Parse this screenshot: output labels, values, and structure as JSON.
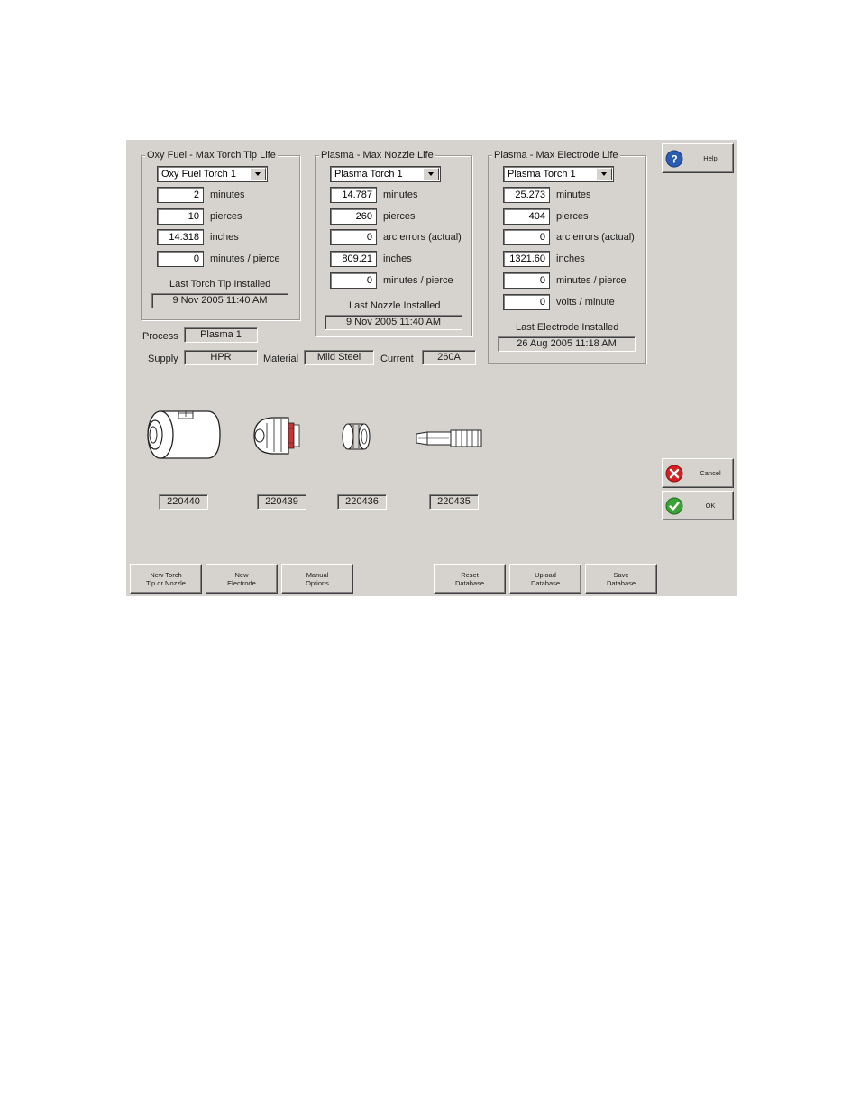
{
  "oxy_group": {
    "title": "Oxy Fuel - Max Torch Tip Life",
    "torch_select": "Oxy Fuel Torch 1",
    "rows": [
      {
        "value": "2",
        "unit": "minutes"
      },
      {
        "value": "10",
        "unit": "pierces"
      },
      {
        "value": "14.318",
        "unit": "inches"
      },
      {
        "value": "0",
        "unit": "minutes / pierce"
      }
    ],
    "last_label": "Last Torch Tip Installed",
    "last_date": "9 Nov 2005  11:40 AM"
  },
  "nozzle_group": {
    "title": "Plasma - Max Nozzle Life",
    "torch_select": "Plasma Torch 1",
    "rows": [
      {
        "value": "14.787",
        "unit": "minutes"
      },
      {
        "value": "260",
        "unit": "pierces"
      },
      {
        "value": "0",
        "unit": "arc errors (actual)"
      },
      {
        "value": "809.21",
        "unit": "inches"
      },
      {
        "value": "0",
        "unit": "minutes / pierce"
      }
    ],
    "last_label": "Last Nozzle Installed",
    "last_date": "9 Nov 2005  11:40 AM"
  },
  "electrode_group": {
    "title": "Plasma - Max Electrode Life",
    "torch_select": "Plasma Torch 1",
    "rows": [
      {
        "value": "25.273",
        "unit": "minutes"
      },
      {
        "value": "404",
        "unit": "pierces"
      },
      {
        "value": "0",
        "unit": "arc errors (actual)"
      },
      {
        "value": "1321.60",
        "unit": "inches"
      },
      {
        "value": "0",
        "unit": "minutes / pierce"
      },
      {
        "value": "0",
        "unit": "volts / minute"
      }
    ],
    "last_label": "Last Electrode Installed",
    "last_date": "26 Aug 2005  11:18 AM"
  },
  "process": {
    "process_label": "Process",
    "process_value": "Plasma 1",
    "supply_label": "Supply",
    "supply_value": "HPR",
    "material_label": "Material",
    "material_value": "Mild Steel",
    "current_label": "Current",
    "current_value": "260A"
  },
  "parts": [
    {
      "number": "220440",
      "icon": "shield-cap-icon"
    },
    {
      "number": "220439",
      "icon": "nozzle-retaining-cap-icon"
    },
    {
      "number": "220436",
      "icon": "swirl-ring-icon"
    },
    {
      "number": "220435",
      "icon": "electrode-icon"
    }
  ],
  "side_buttons": {
    "help": "Help",
    "cancel": "Cancel",
    "ok": "OK"
  },
  "bottom_buttons": {
    "new_torch_tip": "New Torch\nTip or Nozzle",
    "new_electrode": "New\nElectrode",
    "manual_options": "Manual\nOptions",
    "reset_database": "Reset\nDatabase",
    "upload_database": "Upload\nDatabase",
    "save_database": "Save\nDatabase"
  },
  "colors": {
    "panel": "#d6d3ce",
    "help_icon": "#2a5db0",
    "cancel_icon": "#d42020",
    "ok_icon": "#3aa335"
  }
}
